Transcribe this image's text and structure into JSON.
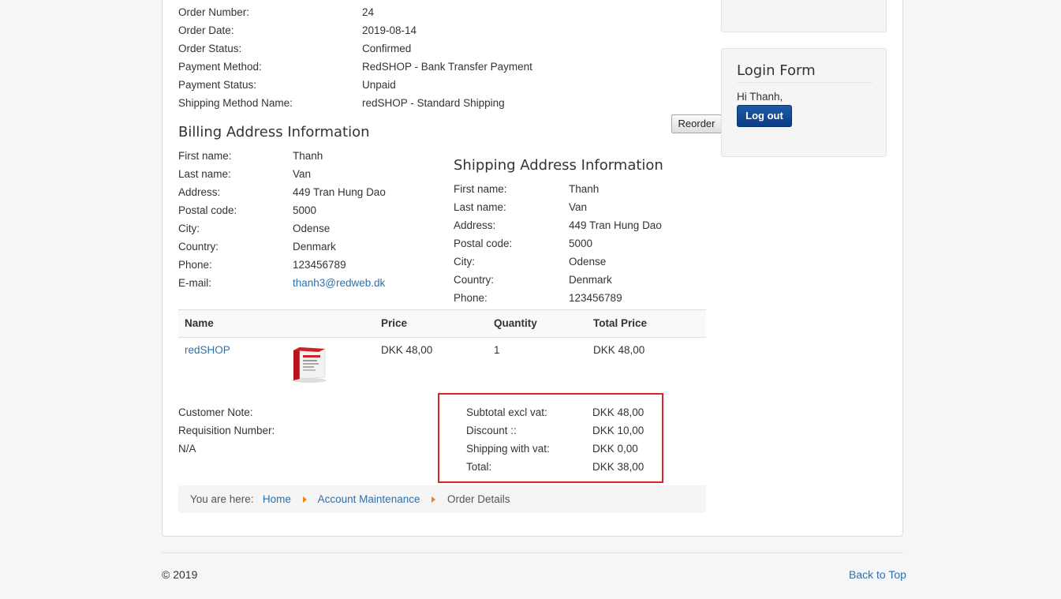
{
  "order_info": [
    {
      "label": "Order Number:",
      "value": "24"
    },
    {
      "label": "Order Date:",
      "value": "2019-08-14"
    },
    {
      "label": "Order Status:",
      "value": "Confirmed"
    },
    {
      "label": "Payment Method:",
      "value": "RedSHOP - Bank Transfer Payment"
    },
    {
      "label": "Payment Status:",
      "value": "Unpaid"
    },
    {
      "label": "Shipping Method Name:",
      "value": "redSHOP - Standard Shipping"
    }
  ],
  "reorder_label": "Reorder",
  "billing": {
    "title": "Billing Address Information",
    "rows": [
      {
        "label": "First name:",
        "value": "Thanh"
      },
      {
        "label": "Last name:",
        "value": "Van"
      },
      {
        "label": "Address:",
        "value": "449 Tran Hung Dao"
      },
      {
        "label": "Postal code:",
        "value": "5000"
      },
      {
        "label": "City:",
        "value": "Odense"
      },
      {
        "label": "Country:",
        "value": "Denmark"
      },
      {
        "label": "Phone:",
        "value": "123456789"
      },
      {
        "label": "E-mail:",
        "value": "thanh3@redweb.dk"
      }
    ]
  },
  "shipping": {
    "title": "Shipping Address Information",
    "rows": [
      {
        "label": "First name:",
        "value": "Thanh"
      },
      {
        "label": "Last name:",
        "value": "Van"
      },
      {
        "label": "Address:",
        "value": "449 Tran Hung Dao"
      },
      {
        "label": "Postal code:",
        "value": "5000"
      },
      {
        "label": "City:",
        "value": "Odense"
      },
      {
        "label": "Country:",
        "value": "Denmark"
      },
      {
        "label": "Phone:",
        "value": "123456789"
      }
    ]
  },
  "table": {
    "headers": {
      "name": "Name",
      "price": "Price",
      "quantity": "Quantity",
      "total": "Total Price"
    },
    "rows": [
      {
        "name": "redSHOP",
        "price": "DKK 48,00",
        "quantity": "1",
        "total": "DKK 48,00"
      }
    ]
  },
  "notes": {
    "customer_note": "Customer Note:",
    "requisition": "Requisition Number:",
    "requisition_value": "N/A"
  },
  "totals": [
    {
      "label": "Subtotal excl vat:",
      "value": "DKK 48,00"
    },
    {
      "label": "Discount ::",
      "value": "DKK 10,00"
    },
    {
      "label": "Shipping with vat:",
      "value": "DKK 0,00"
    },
    {
      "label": "Total:",
      "value": "DKK 38,00"
    }
  ],
  "breadcrumb": {
    "prefix": "You are here:",
    "items": [
      "Home",
      "Account Maintenance",
      "Order Details"
    ]
  },
  "login": {
    "title": "Login Form",
    "greeting": "Hi Thanh,",
    "logout_label": "Log out"
  },
  "footer": {
    "copyright": "© 2019",
    "back_to_top": "Back to Top"
  },
  "colors": {
    "link": "#2f6fab",
    "highlight_border": "#d9242b",
    "logout_button": "#0b3c86",
    "breadcrumb_arrow": "#e8841a"
  }
}
